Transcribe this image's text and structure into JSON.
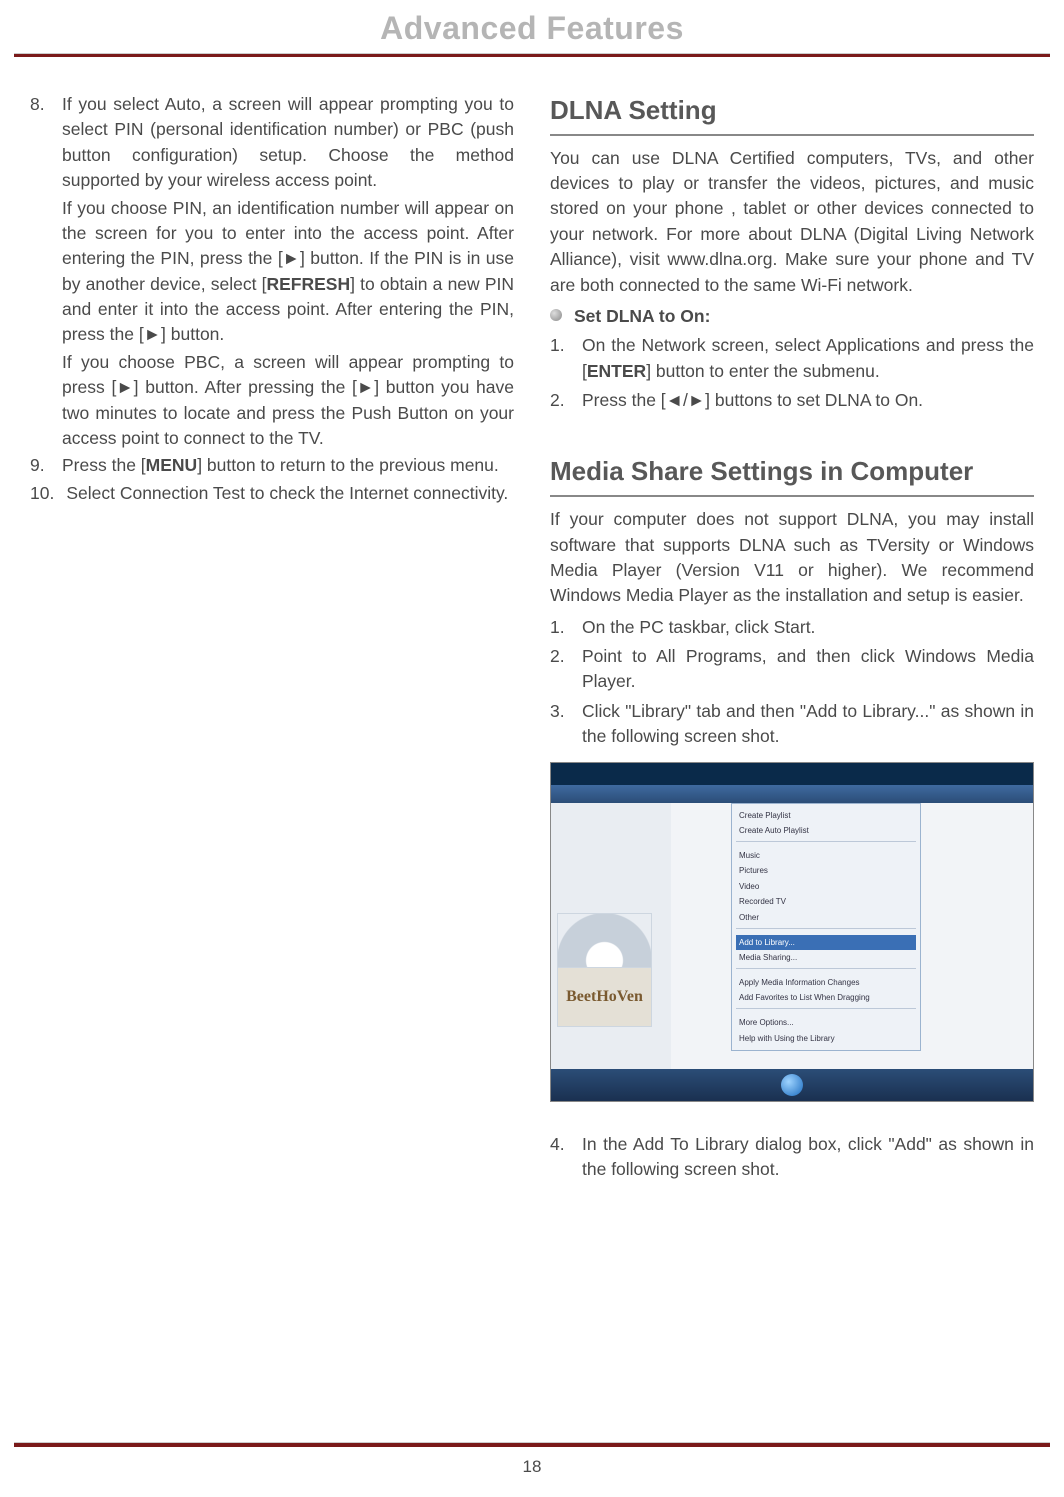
{
  "header": {
    "title": "Advanced Features"
  },
  "left": {
    "item8": {
      "num": "8.",
      "text": "If you select Auto, a screen will appear prompting you to select PIN (personal identification number) or PBC (push button configuration) setup. Choose the method supported by your wireless access point.",
      "pin_para": "If you choose PIN, an identification number will appear on the screen for you to enter into the access point. After entering the PIN, press the [►] button. If the PIN is in use by another device, select [REFRESH] to obtain a new PIN and enter it into the access point. After entering the PIN, press the [►] button.",
      "pbc_para": "If you choose PBC, a screen will appear prompting to press [►] button. After pressing the [►] button you have two minutes to locate and press the Push Button on your access point to connect to the TV."
    },
    "item9": {
      "num": "9.",
      "text": "Press the [MENU] button to return to the previous menu."
    },
    "item10": {
      "num": "10.",
      "text": "Select Connection Test to check the Internet connectivity."
    }
  },
  "right": {
    "dlna_heading": "DLNA Setting",
    "dlna_para": "You can use DLNA Certified computers, TVs, and other devices to play or transfer the videos, pictures, and music stored on your phone , tablet or other devices connected to your network. For more about DLNA (Digital Living Network Alliance), visit www.dlna.org. Make sure your phone and TV are both connected to the same Wi-Fi network.",
    "bullet_set_dlna": "Set DLNA to On:",
    "dlna_step1": {
      "num": "1.",
      "text": "On the Network screen, select Applications and press the [ENTER] button to enter the submenu."
    },
    "dlna_step2": {
      "num": "2.",
      "text": "Press the [◄/►] buttons to set DLNA to On."
    },
    "media_heading": "Media Share Settings in Computer",
    "media_para": "If your computer does not support DLNA, you may install software that supports DLNA such as TVersity or Windows Media Player (Version V11 or higher). We recommend Windows Media Player as the installation and setup is easier.",
    "media_step1": {
      "num": "1.",
      "text": "On the PC taskbar, click Start."
    },
    "media_step2": {
      "num": "2.",
      "text": "Point to All Programs, and then click Windows Media Player."
    },
    "media_step3": {
      "num": "3.",
      "text": "Click \"Library\" tab and then \"Add to Library...\" as shown in the following screen shot."
    },
    "media_step4": {
      "num": "4.",
      "text": "In the Add To Library dialog box, click \"Add\" as shown in the following screen shot."
    }
  },
  "footer": {
    "page": "18"
  },
  "screenshot_menu": {
    "items": [
      "Create Playlist",
      "Create Auto Playlist",
      "Music",
      "Pictures",
      "Video",
      "Recorded TV",
      "Other",
      "Add to Library...",
      "Media Sharing...",
      "Apply Media Information Changes",
      "Add Favorites to List When Dragging",
      "More Options...",
      "Help with Using the Library"
    ],
    "bottomart_label": "BeetHoVen"
  }
}
